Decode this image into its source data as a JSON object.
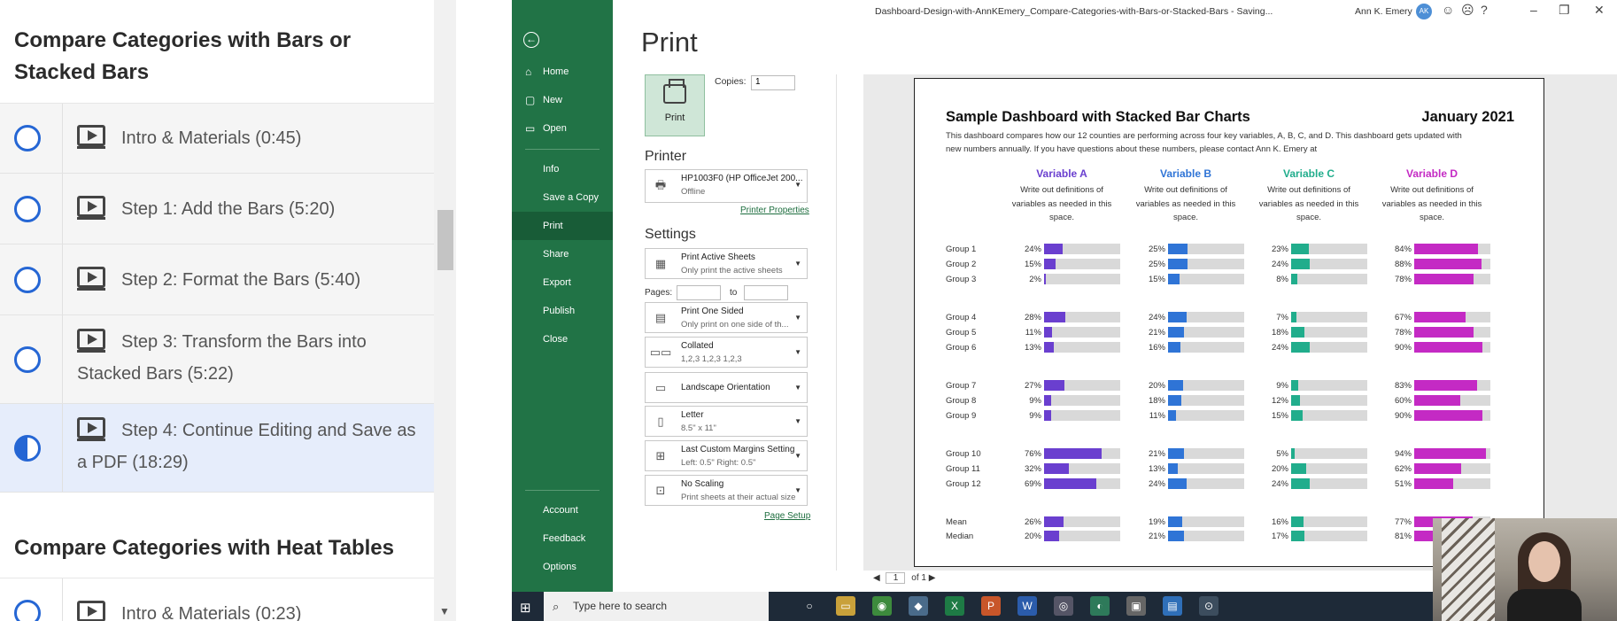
{
  "course": {
    "section1_title": "Compare Categories with Bars or Stacked Bars",
    "lessons": [
      {
        "label": "Intro & Materials (0:45)",
        "state": "incomplete"
      },
      {
        "label": "Step 1: Add the Bars (5:20)",
        "state": "incomplete"
      },
      {
        "label": "Step 2: Format the Bars (5:40)",
        "state": "incomplete"
      },
      {
        "label": "Step 3: Transform the Bars into Stacked Bars (5:22)",
        "state": "incomplete"
      },
      {
        "label": "Step 4: Continue Editing and Save as a PDF (18:29)",
        "state": "in-progress"
      }
    ],
    "section2_title": "Compare Categories with Heat Tables",
    "section2_first": "Intro & Materials (0:23)"
  },
  "excel": {
    "window_title": "Dashboard-Design-with-AnnKEmery_Compare-Categories-with-Bars-or-Stacked-Bars  -  Saving...",
    "user": "Ann K. Emery",
    "avatar_initials": "AK",
    "backstage": {
      "nav_top": [
        "Home",
        "New",
        "Open"
      ],
      "nav_mid": [
        "Info",
        "Save a Copy",
        "Print",
        "Share",
        "Export",
        "Publish",
        "Close"
      ],
      "nav_bottom": [
        "Account",
        "Feedback",
        "Options"
      ],
      "selected": "Print"
    },
    "print": {
      "heading": "Print",
      "button": "Print",
      "copies_label": "Copies:",
      "copies_value": "1",
      "printer_heading": "Printer",
      "printer_name": "HP1003F0 (HP OfficeJet 200...",
      "printer_status": "Offline",
      "printer_properties": "Printer Properties",
      "settings_heading": "Settings",
      "pages_label": "Pages:",
      "pages_to": "to",
      "page_setup": "Page Setup",
      "settings": [
        {
          "l1": "Print Active Sheets",
          "l2": "Only print the active sheets"
        },
        {
          "l1": "Print One Sided",
          "l2": "Only print on one side of th..."
        },
        {
          "l1": "Collated",
          "l2": "1,2,3    1,2,3    1,2,3"
        },
        {
          "l1": "Landscape Orientation",
          "l2": ""
        },
        {
          "l1": "Letter",
          "l2": "8.5\" x 11\""
        },
        {
          "l1": "Last Custom Margins Setting",
          "l2": "Left:  0.5\"    Right:  0.5\""
        },
        {
          "l1": "No Scaling",
          "l2": "Print sheets at their actual size"
        }
      ],
      "page_current": "1",
      "page_of": "of 1"
    },
    "dashboard": {
      "title": "Sample Dashboard with Stacked Bar Charts",
      "date": "January 2021",
      "description": "This dashboard compares how our 12 counties are performing across four key variables, A, B, C, and D. This dashboard gets updated with new numbers annually. If you have questions about these numbers, please contact Ann K. Emery at",
      "definition": "Write out definitions of variables as needed in this space.",
      "variables": [
        {
          "name": "Variable A",
          "color": "#6a3fcf"
        },
        {
          "name": "Variable B",
          "color": "#2f74d6"
        },
        {
          "name": "Variable C",
          "color": "#21ad8c"
        },
        {
          "name": "Variable D",
          "color": "#c42ac4"
        }
      ],
      "rows": [
        {
          "label": "Group 1",
          "values": [
            "24%",
            "25%",
            "23%",
            "84%"
          ]
        },
        {
          "label": "Group 2",
          "values": [
            "15%",
            "25%",
            "24%",
            "88%"
          ]
        },
        {
          "label": "Group 3",
          "values": [
            "2%",
            "15%",
            "8%",
            "78%"
          ]
        },
        {
          "label": "Group 4",
          "values": [
            "28%",
            "24%",
            "7%",
            "67%"
          ]
        },
        {
          "label": "Group 5",
          "values": [
            "11%",
            "21%",
            "18%",
            "78%"
          ]
        },
        {
          "label": "Group 6",
          "values": [
            "13%",
            "16%",
            "24%",
            "90%"
          ]
        },
        {
          "label": "Group 7",
          "values": [
            "27%",
            "20%",
            "9%",
            "83%"
          ]
        },
        {
          "label": "Group 8",
          "values": [
            "9%",
            "18%",
            "12%",
            "60%"
          ]
        },
        {
          "label": "Group 9",
          "values": [
            "9%",
            "11%",
            "15%",
            "90%"
          ]
        },
        {
          "label": "Group 10",
          "values": [
            "76%",
            "21%",
            "5%",
            "94%"
          ]
        },
        {
          "label": "Group 11",
          "values": [
            "32%",
            "13%",
            "20%",
            "62%"
          ]
        },
        {
          "label": "Group 12",
          "values": [
            "69%",
            "24%",
            "24%",
            "51%"
          ]
        },
        {
          "label": "Mean",
          "values": [
            "26%",
            "19%",
            "16%",
            "77%"
          ]
        },
        {
          "label": "Median",
          "values": [
            "20%",
            "21%",
            "17%",
            "81%"
          ]
        }
      ]
    }
  },
  "taskbar": {
    "search_placeholder": "Type here to search"
  }
}
